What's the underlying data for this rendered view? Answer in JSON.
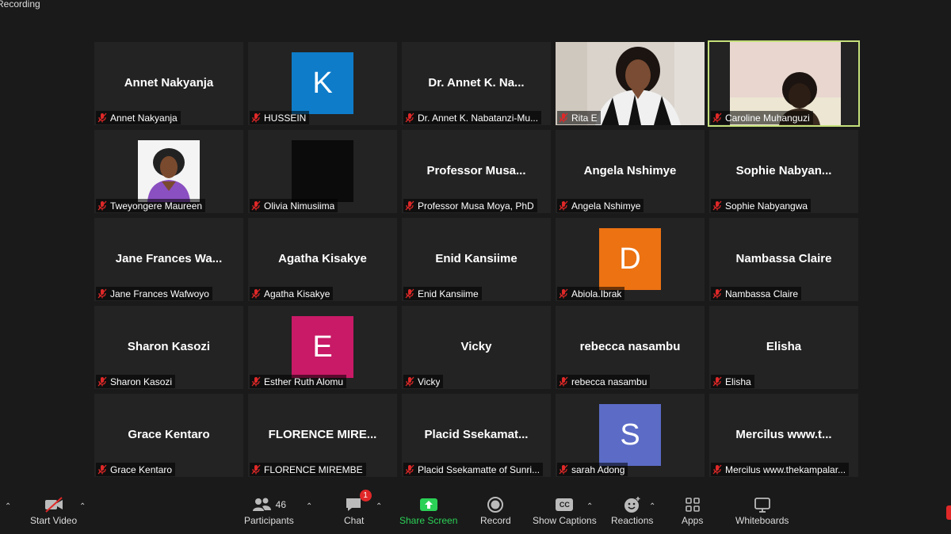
{
  "recording_label": "Recording",
  "tiles": [
    {
      "big_name": "Annet Nakyanja",
      "label": "Annet Nakyanja",
      "type": "name"
    },
    {
      "label": "HUSSEIN",
      "type": "letter",
      "letter": "K",
      "color": "#0e7cc9"
    },
    {
      "big_name": "Dr. Annet K. Na...",
      "label": "Dr. Annet K. Nabatanzi-Mu...",
      "type": "name"
    },
    {
      "label": "Rita E",
      "type": "video-rita"
    },
    {
      "label": "Caroline Muhanguzi",
      "type": "video-caroline",
      "active": true
    },
    {
      "label": "Tweyongere Maureen",
      "type": "photo-maureen"
    },
    {
      "label": "Olivia Nimusiima",
      "type": "black"
    },
    {
      "big_name": "Professor Musa...",
      "label": "Professor Musa Moya, PhD",
      "type": "name"
    },
    {
      "big_name": "Angela Nshimye",
      "label": "Angela Nshimye",
      "type": "name"
    },
    {
      "big_name": "Sophie  Nabyan...",
      "label": "Sophie Nabyangwa",
      "type": "name"
    },
    {
      "big_name": "Jane Frances Wa...",
      "label": "Jane Frances Wafwoyo",
      "type": "name"
    },
    {
      "big_name": "Agatha Kisakye",
      "label": "Agatha Kisakye",
      "type": "name"
    },
    {
      "big_name": "Enid Kansiime",
      "label": "Enid Kansiime",
      "type": "name"
    },
    {
      "label": "Abiola.Ibrak",
      "type": "letter",
      "letter": "D",
      "color": "#ec7212"
    },
    {
      "big_name": "Nambassa Claire",
      "label": "Nambassa Claire",
      "type": "name"
    },
    {
      "big_name": "Sharon Kasozi",
      "label": "Sharon Kasozi",
      "type": "name"
    },
    {
      "label": "Esther Ruth Alomu",
      "type": "letter",
      "letter": "E",
      "color": "#c81a66"
    },
    {
      "big_name": "Vicky",
      "label": "Vicky",
      "type": "name"
    },
    {
      "big_name": "rebecca nasambu",
      "label": "rebecca nasambu",
      "type": "name"
    },
    {
      "big_name": "Elisha",
      "label": "Elisha",
      "type": "name"
    },
    {
      "big_name": "Grace Kentaro",
      "label": "Grace Kentaro",
      "type": "name"
    },
    {
      "big_name": "FLORENCE  MIRE...",
      "label": "FLORENCE MIREMBE",
      "type": "name"
    },
    {
      "big_name": "Placid  Ssekamat...",
      "label": "Placid Ssekamatte of Sunri...",
      "type": "name"
    },
    {
      "label": "sarah Adong",
      "type": "letter",
      "letter": "S",
      "color": "#5b6bc6"
    },
    {
      "big_name": "Mercilus  www.t...",
      "label": "Mercilus www.thekampalar...",
      "type": "name"
    }
  ],
  "toolbar": {
    "start_video": "Start Video",
    "participants": "Participants",
    "participants_count": "46",
    "chat": "Chat",
    "chat_badge": "1",
    "share_screen": "Share Screen",
    "record": "Record",
    "show_captions": "Show Captions",
    "captions_icon_text": "CC",
    "reactions": "Reactions",
    "apps": "Apps",
    "whiteboards": "Whiteboards"
  },
  "colors": {
    "share_green": "#2bd156",
    "active_border": "#c5e07a",
    "muted_red": "#e02828"
  }
}
